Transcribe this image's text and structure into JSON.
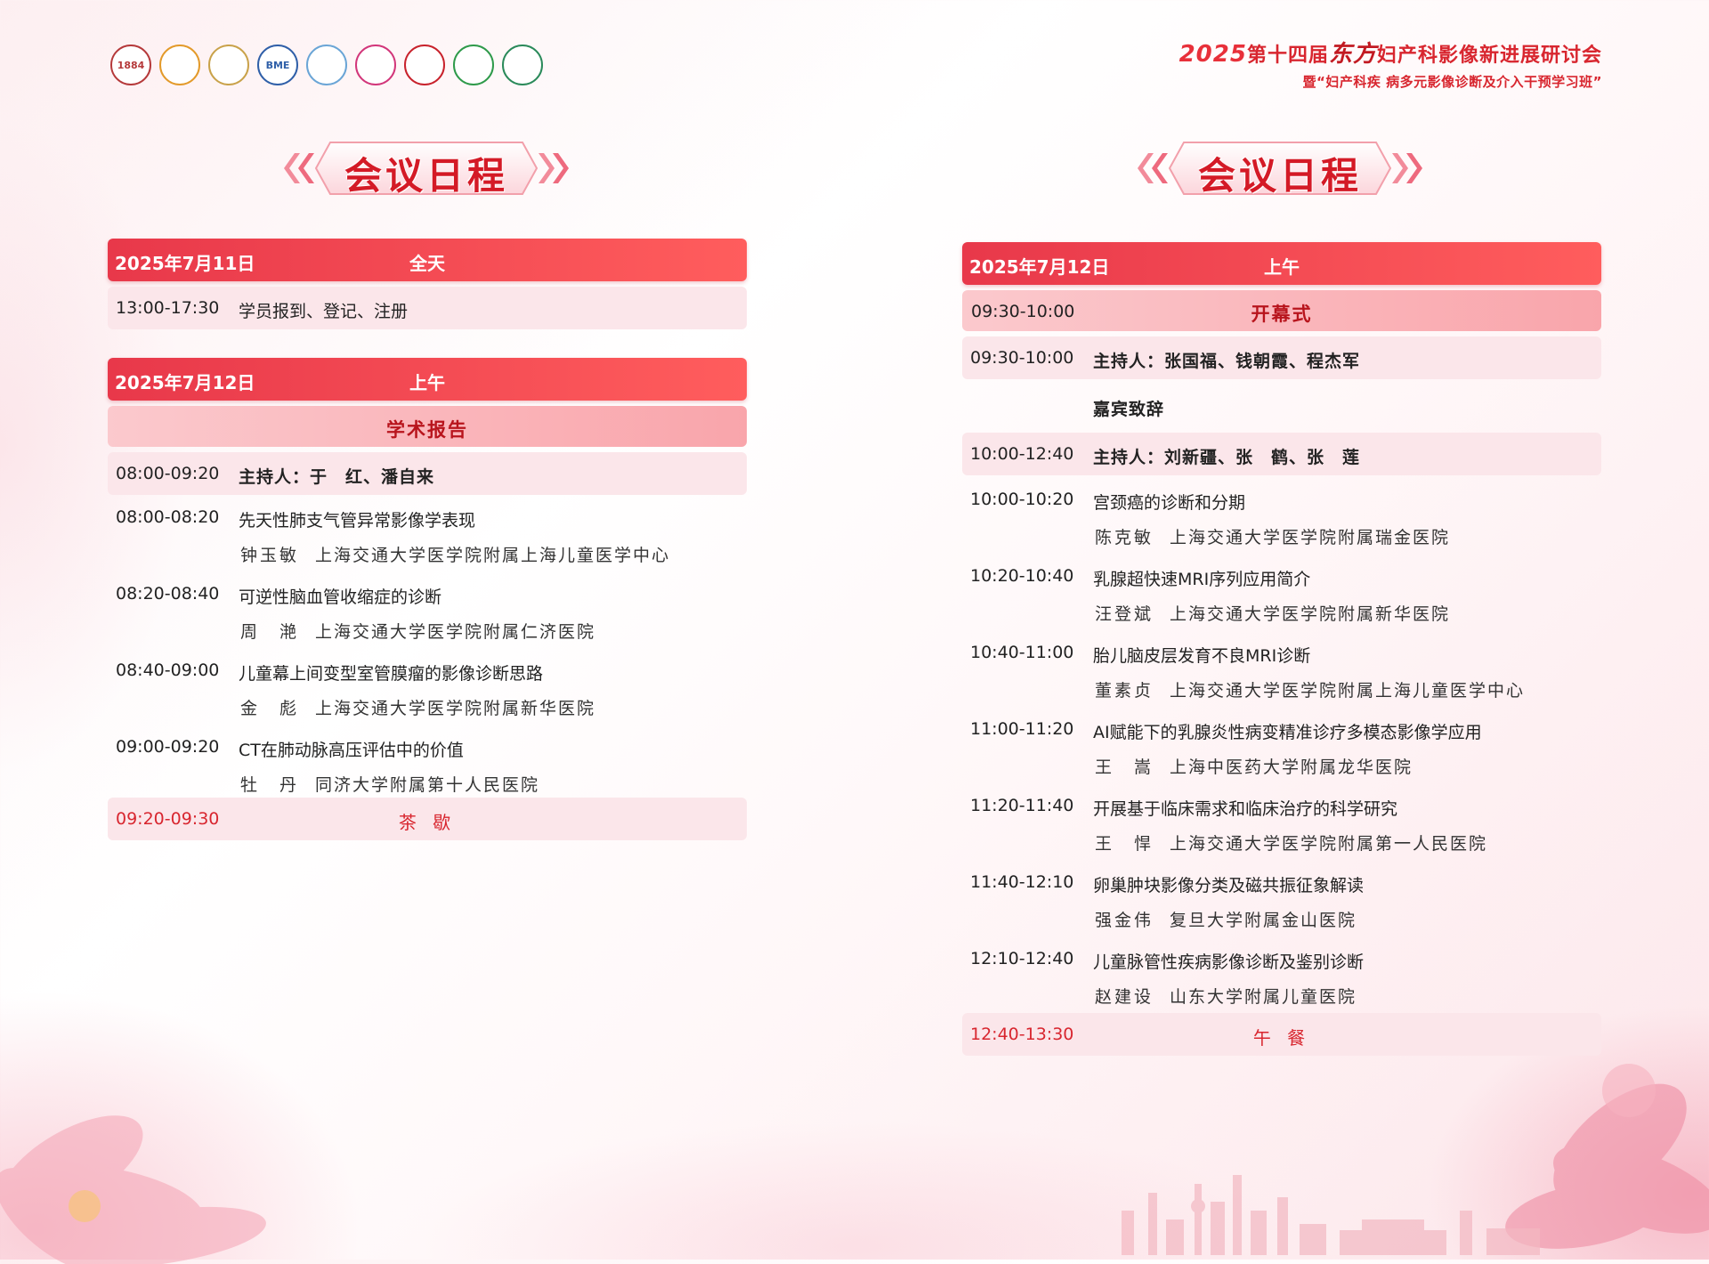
{
  "header": {
    "conference_year": "2025",
    "conference_line1": "第十四届",
    "conference_brand": "东方",
    "conference_line1_rest": "妇产科影像新进展研讨会",
    "conference_line2": "暨“妇产科疾 病多元影像诊断及介入干预学习班”"
  },
  "logos": [
    {
      "icon": "hospital-logo-1",
      "text": "1884",
      "color": "#b5393a"
    },
    {
      "icon": "hospital-logo-2",
      "text": "",
      "color": "#e39a2a"
    },
    {
      "icon": "hospital-logo-3",
      "text": "",
      "color": "#c9a24a"
    },
    {
      "icon": "hospital-logo-4",
      "text": "BME",
      "color": "#2f5fa8"
    },
    {
      "icon": "hospital-logo-5",
      "text": "",
      "color": "#6aa5d6"
    },
    {
      "icon": "hospital-logo-6",
      "text": "",
      "color": "#d2367a"
    },
    {
      "icon": "hospital-logo-7",
      "text": "",
      "color": "#c8222c"
    },
    {
      "icon": "hospital-logo-8",
      "text": "",
      "color": "#2e9a4a"
    },
    {
      "icon": "hospital-logo-9",
      "text": "",
      "color": "#2a8a5a"
    }
  ],
  "left": {
    "banner": "会议日程",
    "day1": {
      "date": "2025年7月11日",
      "period": "全天"
    },
    "registration": {
      "time": "13:00-17:30",
      "label": "学员报到、登记、注册"
    },
    "day2": {
      "date": "2025年7月12日",
      "period": "上午"
    },
    "section": "学术报告",
    "host_row": {
      "time": "08:00-09:20",
      "label": "主持人：于　红、潘自来"
    },
    "talks": [
      {
        "time": "08:00-08:20",
        "title": "先天性肺支气管异常影像学表现",
        "speaker": "钟玉敏",
        "hospital": "上海交通大学医学院附属上海儿童医学中心"
      },
      {
        "time": "08:20-08:40",
        "title": "可逆性脑血管收缩症的诊断",
        "speaker": "周　滟",
        "hospital": "上海交通大学医学院附属仁济医院"
      },
      {
        "time": "08:40-09:00",
        "title": "儿童幕上间变型室管膜瘤的影像诊断思路",
        "speaker": "金　彪",
        "hospital": "上海交通大学医学院附属新华医院"
      },
      {
        "time": "09:00-09:20",
        "title": "CT在肺动脉高压评估中的价值",
        "speaker": "牡　丹",
        "hospital": "同济大学附属第十人民医院"
      }
    ],
    "break": {
      "time": "09:20-09:30",
      "label": "茶 歇"
    }
  },
  "right": {
    "banner": "会议日程",
    "day": {
      "date": "2025年7月12日",
      "period": "上午"
    },
    "opening": {
      "time": "09:30-10:00",
      "label": "开幕式"
    },
    "opening_host": {
      "time": "09:30-10:00",
      "label": "主持人：张国福、钱朝霞、程杰军"
    },
    "guest_speech": "嘉宾致辞",
    "host_row": {
      "time": "10:00-12:40",
      "label": "主持人：刘新疆、张　鹤、张　莲"
    },
    "talks": [
      {
        "time": "10:00-10:20",
        "title": "宫颈癌的诊断和分期",
        "speaker": "陈克敏",
        "hospital": "上海交通大学医学院附属瑞金医院"
      },
      {
        "time": "10:20-10:40",
        "title": "乳腺超快速MRI序列应用简介",
        "speaker": "汪登斌",
        "hospital": "上海交通大学医学院附属新华医院"
      },
      {
        "time": "10:40-11:00",
        "title": "胎儿脑皮层发育不良MRI诊断",
        "speaker": "董素贞",
        "hospital": "上海交通大学医学院附属上海儿童医学中心"
      },
      {
        "time": "11:00-11:20",
        "title": "AI赋能下的乳腺炎性病变精准诊疗多模态影像学应用",
        "speaker": "王　嵩",
        "hospital": "上海中医药大学附属龙华医院"
      },
      {
        "time": "11:20-11:40",
        "title": "开展基于临床需求和临床治疗的科学研究",
        "speaker": "王　悍",
        "hospital": "上海交通大学医学院附属第一人民医院"
      },
      {
        "time": "11:40-12:10",
        "title": "卵巢肿块影像分类及磁共振征象解读",
        "speaker": "强金伟",
        "hospital": "复旦大学附属金山医院"
      },
      {
        "time": "12:10-12:40",
        "title": "儿童脉管性疾病影像诊断及鉴别诊断",
        "speaker": "赵建设",
        "hospital": "山东大学附属儿童医院"
      }
    ],
    "break": {
      "time": "12:40-13:30",
      "label": "午 餐"
    }
  }
}
